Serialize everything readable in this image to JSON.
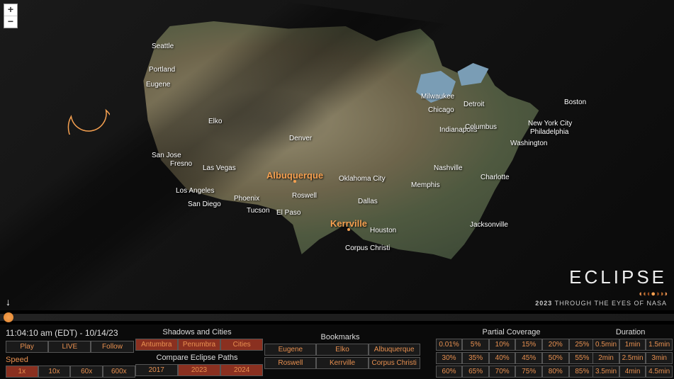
{
  "map": {
    "zoom_in": "+",
    "zoom_out": "−",
    "cities": {
      "seattle": "Seattle",
      "portland": "Portland",
      "eugene": "Eugene",
      "san_jose": "San Jose",
      "fresno": "Fresno",
      "los_angeles": "Los Angeles",
      "san_diego": "San Diego",
      "las_vegas": "Las Vegas",
      "elko": "Elko",
      "phoenix": "Phoenix",
      "tucson": "Tucson",
      "denver": "Denver",
      "albuquerque": "Albuquerque",
      "roswell": "Roswell",
      "el_paso": "El Paso",
      "kerrville": "Kerrville",
      "dallas": "Dallas",
      "houston": "Houston",
      "corpus_christi": "Corpus Christi",
      "oklahoma_city": "Oklahoma City",
      "milwaukee": "Milwaukee",
      "chicago": "Chicago",
      "detroit": "Detroit",
      "indianapolis": "Indianapolis",
      "columbus": "Columbus",
      "memphis": "Memphis",
      "nashville": "Nashville",
      "charlotte": "Charlotte",
      "jacksonville": "Jacksonville",
      "boston": "Boston",
      "new_york_city": "New York City",
      "philadelphia": "Philadelphia",
      "washington": "Washington"
    }
  },
  "logo": {
    "title": "ECLIPSE",
    "year": "2023",
    "tagline": "THROUGH THE EYES OF NASA"
  },
  "time": {
    "display": "11:04:10 am (EDT) - 10/14/23",
    "play": "Play",
    "live": "LIVE",
    "follow": "Follow",
    "speed_label": "Speed",
    "speeds": [
      "1x",
      "10x",
      "60x",
      "600x"
    ],
    "active_speed": "1x"
  },
  "shadows": {
    "title": "Shadows and Cities",
    "options": [
      "Antumbra",
      "Penumbra",
      "Cities"
    ],
    "compare_title": "Compare Eclipse Paths",
    "years": [
      "2017",
      "2023",
      "2024"
    ],
    "active_year": "2023"
  },
  "bookmarks": {
    "title": "Bookmarks",
    "row1": [
      "Eugene",
      "Elko",
      "Albuquerque"
    ],
    "row2": [
      "Roswell",
      "Kerrville",
      "Corpus Christi"
    ]
  },
  "coverage": {
    "title": "Partial Coverage",
    "row1": [
      "0.01%",
      "5%",
      "10%",
      "15%",
      "20%",
      "25%"
    ],
    "row2": [
      "30%",
      "35%",
      "40%",
      "45%",
      "50%",
      "55%"
    ],
    "row3": [
      "60%",
      "65%",
      "70%",
      "75%",
      "80%",
      "85%"
    ]
  },
  "duration": {
    "title": "Duration",
    "row1": [
      "0.5min",
      "1min",
      "1.5min"
    ],
    "row2": [
      "2min",
      "2.5min",
      "3min"
    ],
    "row3": [
      "3.5min",
      "4min",
      "4.5min"
    ]
  }
}
